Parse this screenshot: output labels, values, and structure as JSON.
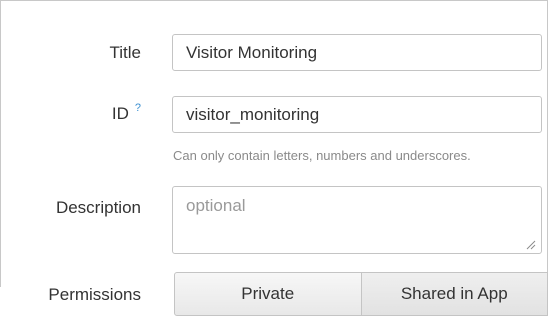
{
  "form": {
    "title": {
      "label": "Title",
      "value": "Visitor Monitoring"
    },
    "id": {
      "label": "ID",
      "help_mark": "?",
      "value": "visitor_monitoring",
      "hint": "Can only contain letters, numbers and underscores."
    },
    "description": {
      "label": "Description",
      "placeholder": "optional",
      "value": ""
    },
    "permissions": {
      "label": "Permissions",
      "options": [
        "Private",
        "Shared in App"
      ]
    }
  },
  "icons": {
    "help": "help-icon",
    "resize": "resize-grip-icon"
  }
}
